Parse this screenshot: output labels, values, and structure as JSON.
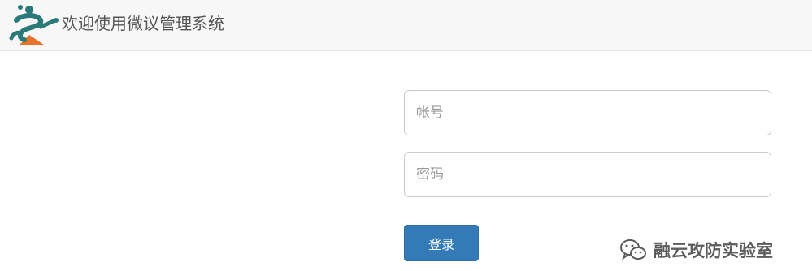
{
  "header": {
    "title": "欢迎使用微议管理系统",
    "logo": "app-logo-icon"
  },
  "login_form": {
    "username_placeholder": "帐号",
    "username_value": "",
    "password_placeholder": "密码",
    "password_value": "",
    "submit_label": "登录"
  },
  "watermark": {
    "icon": "wechat-icon",
    "text": "融云攻防实验室"
  },
  "colors": {
    "header_bg": "#f7f7f7",
    "primary_button": "#337ab7",
    "logo_teal": "#2a7a7a",
    "logo_orange": "#e8742c"
  }
}
